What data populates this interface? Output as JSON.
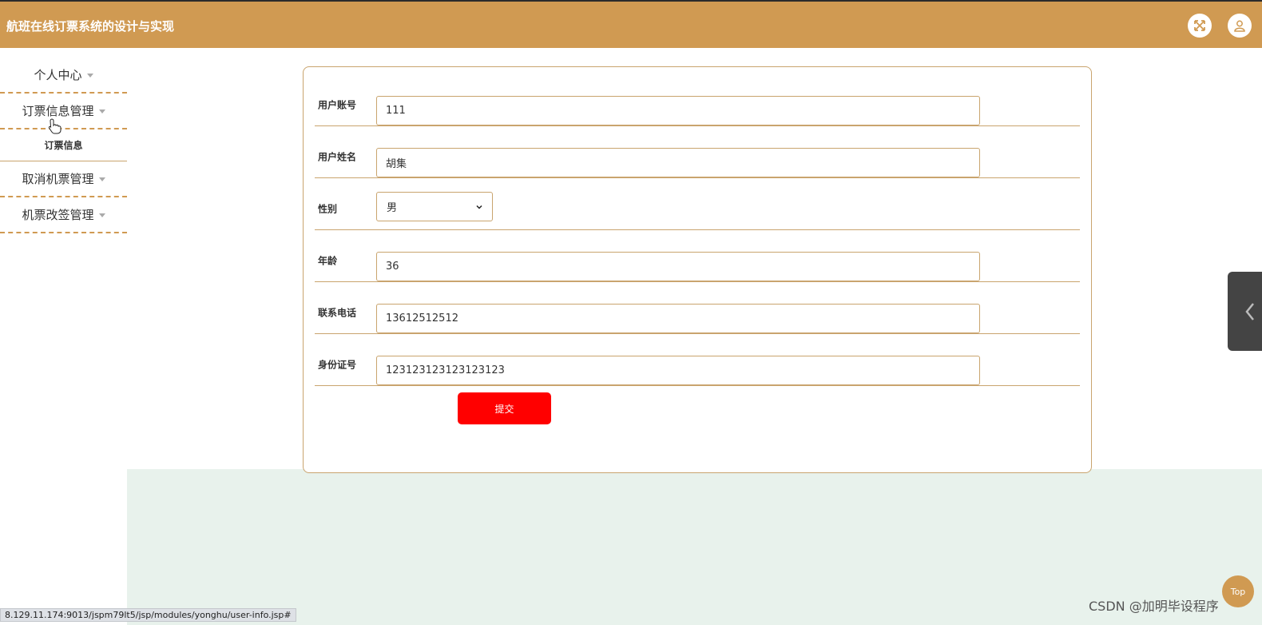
{
  "header": {
    "title": "航班在线订票系统的设计与实现"
  },
  "sidebar": {
    "items": [
      {
        "label": "个人中心"
      },
      {
        "label": "订票信息管理",
        "children": [
          {
            "label": "订票信息"
          }
        ]
      },
      {
        "label": "取消机票管理"
      },
      {
        "label": "机票改签管理"
      }
    ]
  },
  "form": {
    "fields": [
      {
        "label": "用户账号",
        "value": "111"
      },
      {
        "label": "用户姓名",
        "value": "胡集"
      },
      {
        "label": "性别",
        "value": "男"
      },
      {
        "label": "年龄",
        "value": "36"
      },
      {
        "label": "联系电话",
        "value": "13612512512"
      },
      {
        "label": "身份证号",
        "value": "123123123123123123"
      }
    ],
    "submit_label": "提交"
  },
  "floating": {
    "top_label": "Top"
  },
  "watermark": "CSDN @加明毕设程序",
  "status_url": "8.129.11.174:9013/jspm79lt5/jsp/modules/yonghu/user-info.jsp#",
  "colors": {
    "header_bg": "#d09a52",
    "accent": "#d09a52",
    "submit_bg": "#ff0000",
    "content_bg": "#e8f2ec"
  }
}
